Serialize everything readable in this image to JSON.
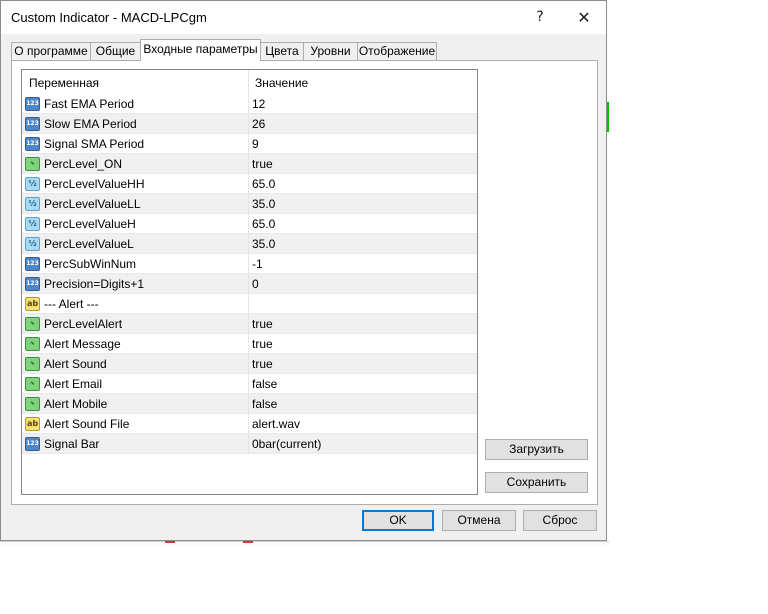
{
  "window": {
    "title": "Custom Indicator - MACD-LPCgm",
    "help_glyph": "?",
    "close_glyph": "✕"
  },
  "tabs": [
    {
      "label": "О программе",
      "active": false
    },
    {
      "label": "Общие",
      "active": false
    },
    {
      "label": "Входные параметры",
      "active": true
    },
    {
      "label": "Цвета",
      "active": false
    },
    {
      "label": "Уровни",
      "active": false
    },
    {
      "label": "Отображение",
      "active": false
    }
  ],
  "grid": {
    "columns": [
      "Переменная",
      "Значение"
    ],
    "rows": [
      {
        "icon": "int",
        "icon_text": "123",
        "name": "Fast EMA Period",
        "value": "12"
      },
      {
        "icon": "int",
        "icon_text": "123",
        "name": "Slow EMA Period",
        "value": "26"
      },
      {
        "icon": "int",
        "icon_text": "123",
        "name": "Signal SMA Period",
        "value": "9"
      },
      {
        "icon": "bool",
        "icon_text": "∿",
        "name": "PercLevel_ON",
        "value": "true"
      },
      {
        "icon": "dbl",
        "icon_text": "½",
        "name": "PercLevelValueHH",
        "value": "65.0"
      },
      {
        "icon": "dbl",
        "icon_text": "½",
        "name": "PercLevelValueLL",
        "value": "35.0"
      },
      {
        "icon": "dbl",
        "icon_text": "½",
        "name": "PercLevelValueH",
        "value": "65.0"
      },
      {
        "icon": "dbl",
        "icon_text": "½",
        "name": "PercLevelValueL",
        "value": "35.0"
      },
      {
        "icon": "int",
        "icon_text": "123",
        "name": "PercSubWinNum",
        "value": "-1"
      },
      {
        "icon": "int",
        "icon_text": "123",
        "name": "Precision=Digits+1",
        "value": "0"
      },
      {
        "icon": "str",
        "icon_text": "ab",
        "name": "--- Alert  ---",
        "value": ""
      },
      {
        "icon": "bool",
        "icon_text": "∿",
        "name": "PercLevelAlert",
        "value": "true"
      },
      {
        "icon": "bool",
        "icon_text": "∿",
        "name": "Alert Message",
        "value": "true"
      },
      {
        "icon": "bool",
        "icon_text": "∿",
        "name": "Alert Sound",
        "value": "true"
      },
      {
        "icon": "bool",
        "icon_text": "∿",
        "name": "Alert Email",
        "value": "false"
      },
      {
        "icon": "bool",
        "icon_text": "∿",
        "name": "Alert Mobile",
        "value": "false"
      },
      {
        "icon": "str",
        "icon_text": "ab",
        "name": "Alert Sound File",
        "value": "alert.wav"
      },
      {
        "icon": "int",
        "icon_text": "123",
        "name": "Signal Bar",
        "value": "0bar(current)"
      }
    ]
  },
  "buttons": {
    "load": "Загрузить",
    "save": "Сохранить",
    "ok": "OK",
    "cancel": "Отмена",
    "reset": "Сброс"
  },
  "colors": {
    "accent": "#0078d7",
    "row_alt": "#f0f0f0"
  }
}
